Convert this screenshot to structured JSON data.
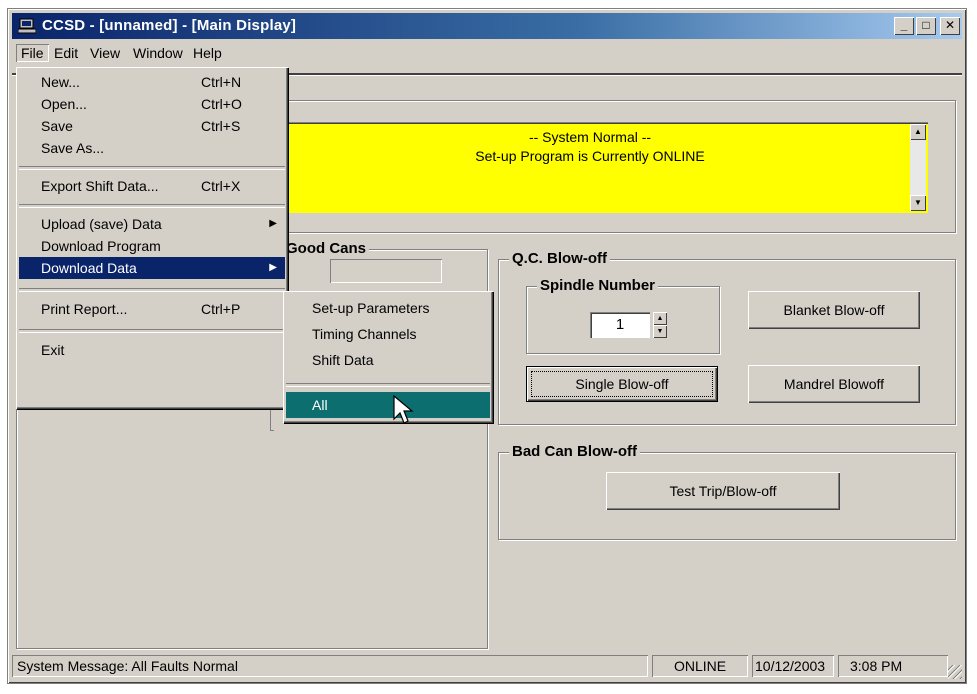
{
  "window": {
    "title": "CCSD - [unnamed] - [Main Display]",
    "controls": {
      "minimize": "_",
      "maximize": "□",
      "close": "✕"
    }
  },
  "menubar": [
    "File",
    "Edit",
    "View",
    "Window",
    "Help"
  ],
  "file_menu": {
    "new": {
      "label": "New...",
      "shortcut": "Ctrl+N"
    },
    "open": {
      "label": "Open...",
      "shortcut": "Ctrl+O"
    },
    "save": {
      "label": "Save",
      "shortcut": "Ctrl+S"
    },
    "save_as": {
      "label": "Save As..."
    },
    "export_shift": {
      "label": "Export Shift Data...",
      "shortcut": "Ctrl+X"
    },
    "upload": {
      "label": "Upload (save) Data"
    },
    "download_program": {
      "label": "Download Program"
    },
    "download_data": {
      "label": "Download Data"
    },
    "print_report": {
      "label": "Print Report...",
      "shortcut": "Ctrl+P"
    },
    "exit": {
      "label": "Exit"
    }
  },
  "download_submenu": [
    "Set-up Parameters",
    "Timing Channels",
    "Shift Data",
    "All"
  ],
  "message_panel": {
    "line1": "-- System Normal --",
    "line2": "Set-up Program is Currently ONLINE"
  },
  "good_cans": {
    "title": "Good Cans"
  },
  "qc_blowoff": {
    "title": "Q.C. Blow-off",
    "spindle_title": "Spindle Number",
    "spindle_value": "1",
    "blanket_button": "Blanket Blow-off",
    "single_button": "Single Blow-off",
    "mandrel_button": "Mandrel Blowoff"
  },
  "bad_can": {
    "title": "Bad Can Blow-off",
    "test_button": "Test Trip/Blow-off"
  },
  "statusbar": {
    "message": "System Message:  All Faults Normal",
    "mode": "ONLINE",
    "date": "10/12/2003",
    "time": "3:08 PM"
  },
  "colors": {
    "face": "#d4d0c8",
    "titlebar": "#0a246a",
    "message_bg": "#ffff00",
    "menu_highlight": "#0a246a",
    "submenu_highlight": "#0c6e6e"
  }
}
